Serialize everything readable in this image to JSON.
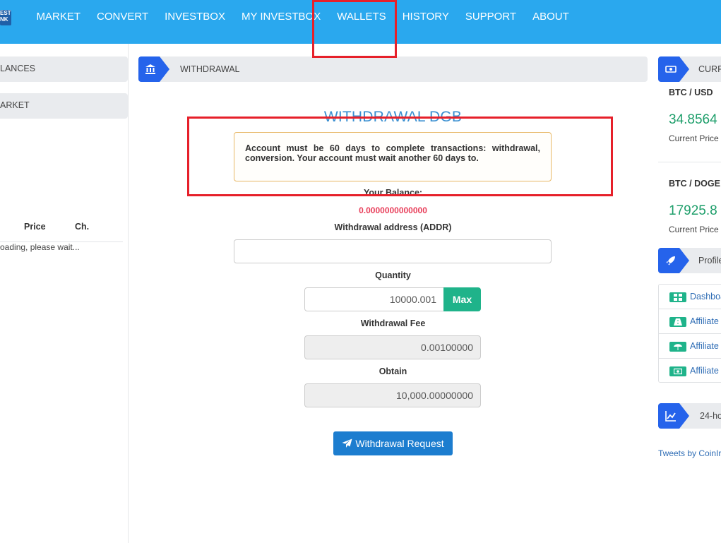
{
  "logo": {
    "line1": "EST",
    "line2": "NK"
  },
  "nav": [
    {
      "label": "MARKET"
    },
    {
      "label": "CONVERT"
    },
    {
      "label": "INVESTBOX"
    },
    {
      "label": "MY INVESTBOX"
    },
    {
      "label": "WALLETS"
    },
    {
      "label": "HISTORY"
    },
    {
      "label": "SUPPORT"
    },
    {
      "label": "ABOUT"
    }
  ],
  "left": {
    "balances_title": "LANCES",
    "market_title": "ARKET",
    "table_headers": {
      "price": "Price",
      "change": "Ch."
    },
    "loading_text": "oading, please wait..."
  },
  "breadcrumb": {
    "title": "WITHDRAWAL"
  },
  "form": {
    "heading": "WITHDRAWAL DGB",
    "alert_text": "Account must be 60 days to complete transactions: withdrawal, conversion. Your account must wait another 60 days to.",
    "balance_label": "Your Balance:",
    "balance_value": "0.0000000000000",
    "address_label": "Withdrawal address (ADDR)",
    "address_value": "",
    "quantity_label": "Quantity",
    "quantity_value": "10000.001",
    "max_label": "Max",
    "fee_label": "Withdrawal Fee",
    "fee_value": "0.00100000",
    "obtain_label": "Obtain",
    "obtain_value": "10,000.00000000",
    "submit_label": "Withdrawal Request"
  },
  "right": {
    "currency_title": "CURR",
    "pair1": "BTC / USD",
    "price1": "34.8564",
    "pair2": "BTC / DOGE",
    "price2": "17925.8",
    "price_caption": "Current Price",
    "profile_title": "Profile",
    "profile_items": [
      {
        "label": "Dashboa"
      },
      {
        "label": "Affiliate"
      },
      {
        "label": "Affiliate I"
      },
      {
        "label": "Affiliate I"
      }
    ],
    "chart_title": "24-ho",
    "tweets": "Tweets by CoinIr"
  },
  "colors": {
    "nav_bg": "#2aa8ee",
    "accent_blue": "#2563eb",
    "success_green": "#1fb38a",
    "balance_red": "#e83e5a",
    "highlight_red": "#e6202a"
  }
}
